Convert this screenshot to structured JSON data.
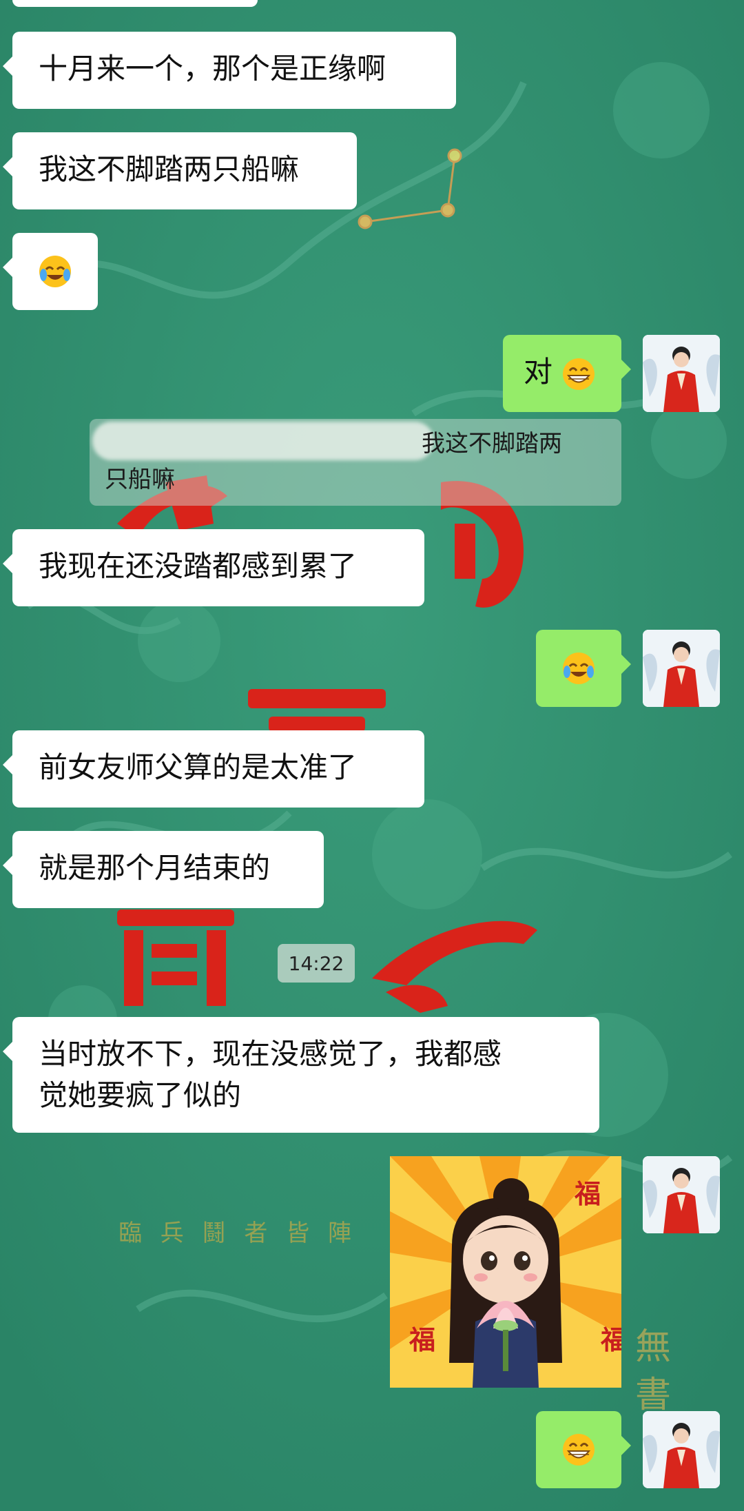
{
  "messages": [
    {
      "id": "m1",
      "side": "left",
      "text": "十月来一个，那个是正缘啊"
    },
    {
      "id": "m2",
      "side": "left",
      "text": "我这不脚踏两只船嘛"
    },
    {
      "id": "m3",
      "side": "left",
      "emoji": "crying-laughing-emoji"
    },
    {
      "id": "m4",
      "side": "right",
      "text": "对",
      "emoji": "grinning-emoji"
    },
    {
      "id": "m5",
      "side": "left",
      "text": "我现在还没踏都感到累了"
    },
    {
      "id": "m6",
      "side": "right",
      "emoji": "crying-laughing-emoji"
    },
    {
      "id": "m7",
      "side": "left",
      "text": "前女友师父算的是太准了"
    },
    {
      "id": "m8",
      "side": "left",
      "text": "就是那个月结束的"
    },
    {
      "id": "m9",
      "side": "left",
      "text_line1": "当时放不下，现在没感觉了，我都感",
      "text_line2": "觉她要疯了似的"
    },
    {
      "id": "m10",
      "side": "right",
      "sticker": "girl-with-lotus-sticker",
      "sticker_chars": [
        "福",
        "福",
        "福"
      ]
    },
    {
      "id": "m11",
      "side": "right",
      "emoji": "grinning-emoji"
    }
  ],
  "quote": {
    "line1": "我这不脚踏两",
    "line2": "只船嘛"
  },
  "timestamp": "14:22",
  "background_text": {
    "seal_line": "臨 兵 鬪 者 皆 陣",
    "side_chars": "無 書"
  },
  "colors": {
    "background": "#2f8f6e",
    "left_bubble": "#ffffff",
    "right_bubble": "#95ec69",
    "seal_red": "#d9231a"
  }
}
